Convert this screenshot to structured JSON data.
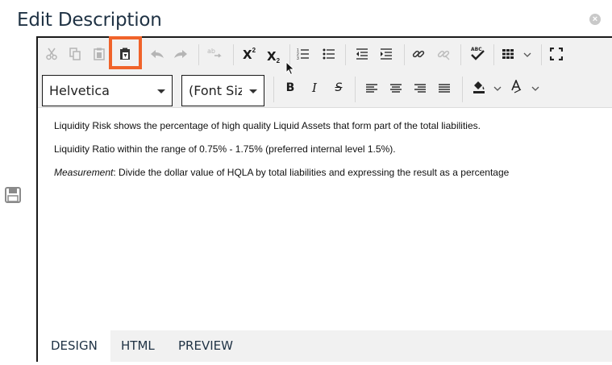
{
  "dialog": {
    "title": "Edit Description"
  },
  "toolbar": {
    "row1_icons": [
      "cut-icon",
      "copy-icon",
      "paste-icon",
      "paste-from-word-icon",
      "undo-icon",
      "redo-icon",
      "spell-replace-icon",
      "superscript-icon",
      "subscript-icon",
      "ordered-list-icon",
      "unordered-list-icon",
      "outdent-icon",
      "indent-icon",
      "link-icon",
      "unlink-icon",
      "spellcheck-icon",
      "table-icon",
      "fullscreen-icon"
    ],
    "superscript_label": "X",
    "subscript_label": "X",
    "font_family": "Helvetica",
    "font_size": "(Font Size)",
    "bold_label": "B",
    "italic_label": "I",
    "strike_label": "S",
    "highlight_color": "#f0632a"
  },
  "content": {
    "paragraph1": "Liquidity Risk shows the percentage of high quality Liquid Assets that form part of the total liabilities.",
    "paragraph2": "Liquidity Ratio within the range of 0.75% - 1.75% (preferred internal level 1.5%).",
    "paragraph3_em": "Measurement",
    "paragraph3_rest": ": Divide the dollar value of HQLA by total liabilities and expressing the result as a percentage"
  },
  "tabs": {
    "design": "DESIGN",
    "html": "HTML",
    "preview": "PREVIEW"
  }
}
